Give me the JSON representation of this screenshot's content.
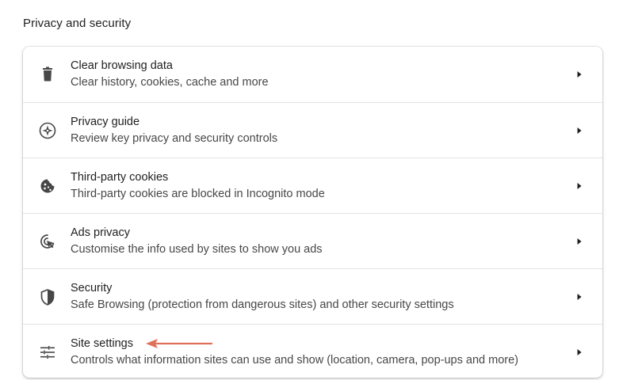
{
  "section": {
    "title": "Privacy and security"
  },
  "rows": [
    {
      "icon": "trash-icon",
      "title": "Clear browsing data",
      "subtitle": "Clear history, cookies, cache and more"
    },
    {
      "icon": "compass-icon",
      "title": "Privacy guide",
      "subtitle": "Review key privacy and security controls"
    },
    {
      "icon": "cookie-icon",
      "title": "Third-party cookies",
      "subtitle": "Third-party cookies are blocked in Incognito mode"
    },
    {
      "icon": "ads-privacy-icon",
      "title": "Ads privacy",
      "subtitle": "Customise the info used by sites to show you ads"
    },
    {
      "icon": "shield-icon",
      "title": "Security",
      "subtitle": "Safe Browsing (protection from dangerous sites) and other security settings"
    },
    {
      "icon": "tune-sliders-icon",
      "title": "Site settings",
      "subtitle": "Controls what information sites can use and show (location, camera, pop-ups and more)"
    }
  ],
  "colors": {
    "text_primary": "#1f1f1f",
    "text_secondary": "#474747",
    "icon": "#474747",
    "divider": "#e3e3e3",
    "annotation_arrow": "#e0705a"
  }
}
